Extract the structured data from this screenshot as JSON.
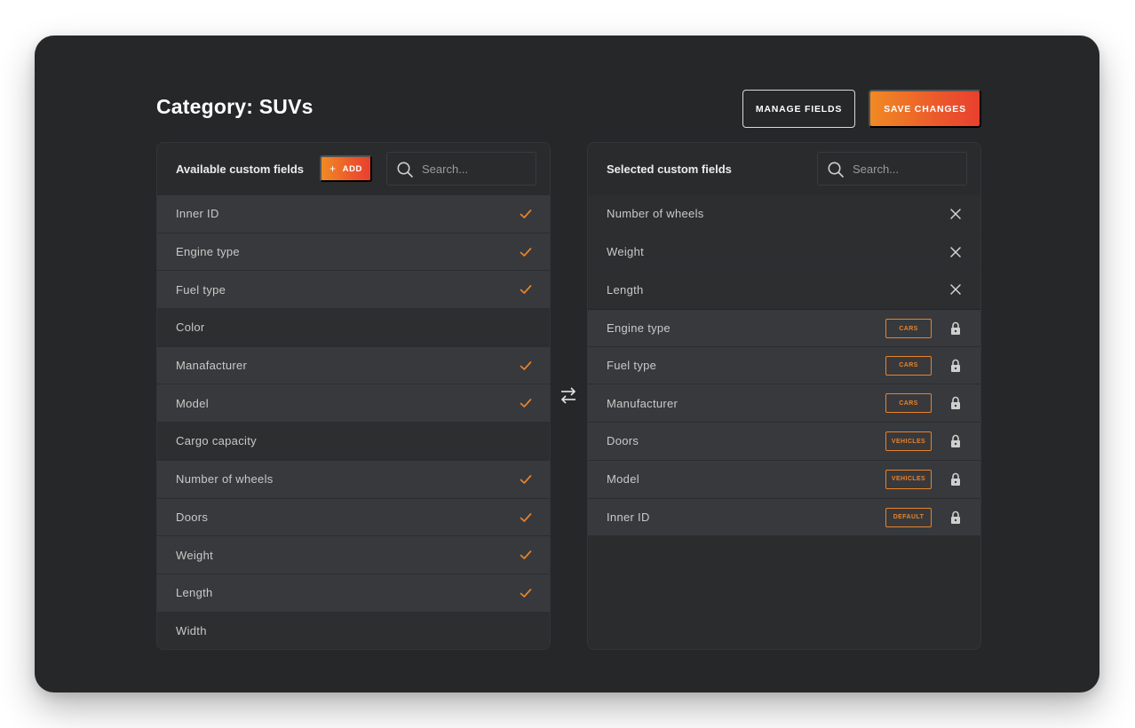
{
  "header": {
    "title_prefix": "Category: ",
    "title_category": "SUVs",
    "manage_label": "MANAGE FIELDS",
    "save_label": "SAVE CHANGES"
  },
  "available": {
    "title": "Available custom fields",
    "add_label": "ADD",
    "add_icon": "plus",
    "search_placeholder": "Search...",
    "items": [
      {
        "label": "Inner ID",
        "checked": true
      },
      {
        "label": "Engine type",
        "checked": true
      },
      {
        "label": "Fuel type",
        "checked": true
      },
      {
        "label": "Color",
        "checked": false
      },
      {
        "label": "Manafacturer",
        "checked": true
      },
      {
        "label": "Model",
        "checked": true
      },
      {
        "label": "Cargo capacity",
        "checked": false
      },
      {
        "label": "Number of wheels",
        "checked": true
      },
      {
        "label": "Doors",
        "checked": true
      },
      {
        "label": "Weight",
        "checked": true
      },
      {
        "label": "Length",
        "checked": true
      },
      {
        "label": "Width",
        "checked": false
      }
    ]
  },
  "selected": {
    "title": "Selected custom fields",
    "search_placeholder": "Search...",
    "removable": [
      {
        "label": "Number of wheels"
      },
      {
        "label": "Weight"
      },
      {
        "label": "Length"
      }
    ],
    "locked": [
      {
        "label": "Engine type",
        "tag": "CARS"
      },
      {
        "label": "Fuel type",
        "tag": "CARS"
      },
      {
        "label": "Manufacturer",
        "tag": "CARS"
      },
      {
        "label": "Doors",
        "tag": "VEHICLES"
      },
      {
        "label": "Model",
        "tag": "VEHICLES"
      },
      {
        "label": "Inner ID",
        "tag": "DEFAULT"
      }
    ]
  },
  "icons": {
    "check": "check-icon",
    "remove": "close-icon",
    "lock": "lock-icon",
    "search": "search-icon",
    "swap": "swap-arrows-icon"
  },
  "colors": {
    "accent": "#e8832a",
    "background": "#262729",
    "panel": "#2b2c2e"
  }
}
